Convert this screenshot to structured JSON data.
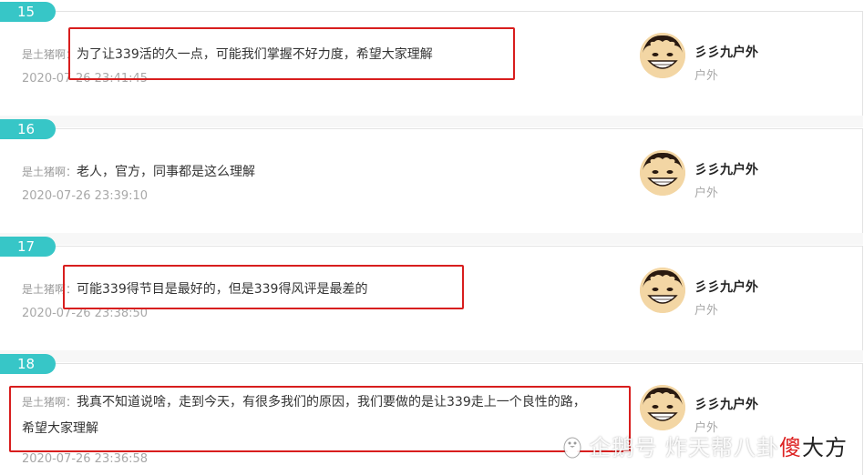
{
  "comments": [
    {
      "floor": "15",
      "author_prefix": "是土猪啊：",
      "text": "为了让339活的久一点，可能我们掌握不好力度，希望大家理解",
      "time": "2020-07-26 23:41:45",
      "user_name": "彡彡九户外",
      "user_category": "户外"
    },
    {
      "floor": "16",
      "author_prefix": "是土猪啊：",
      "text": "老人，官方，同事都是这么理解",
      "time": "2020-07-26 23:39:10",
      "user_name": "彡彡九户外",
      "user_category": "户外"
    },
    {
      "floor": "17",
      "author_prefix": "是土猪啊：",
      "text": "可能339得节目是最好的，但是339得风评是最差的",
      "time": "2020-07-26 23:38:50",
      "user_name": "彡彡九户外",
      "user_category": "户外"
    },
    {
      "floor": "18",
      "author_prefix": "是土猪啊：",
      "text": "我真不知道说啥，走到今天，有很多我们的原因，我们要做的是让339走上一个良性的路，希望大家理解",
      "time": "2020-07-26 23:36:58",
      "user_name": "彡彡九户外",
      "user_category": "户外"
    }
  ],
  "watermark": {
    "prefix": "企鹅号",
    "channel": "炸天帮八卦",
    "brand_char": "傻",
    "tail": "大方"
  },
  "colors": {
    "floor_tag": "#37c6c7",
    "highlight_box": "#d81e1e"
  },
  "icons": {
    "avatar": "cartoon-face-avatar",
    "watermark_logo": "penguin-icon"
  }
}
